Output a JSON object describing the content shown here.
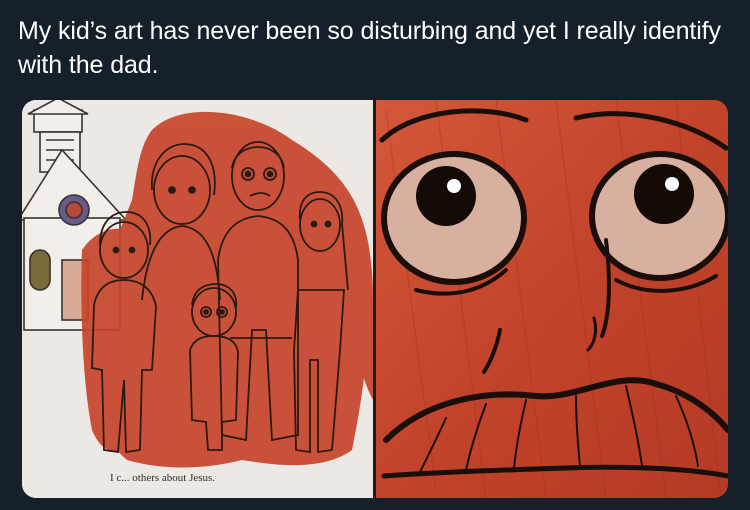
{
  "tweet": {
    "text": "My kid’s art has never been so disturbing and yet I really identify with the dad."
  },
  "media": {
    "left_panel": {
      "caption": "I c... others about Jesus."
    }
  },
  "colors": {
    "background": "#15202b",
    "text": "#ffffff",
    "paint_red": "#c9492e",
    "paper": "#e9e6e2"
  }
}
